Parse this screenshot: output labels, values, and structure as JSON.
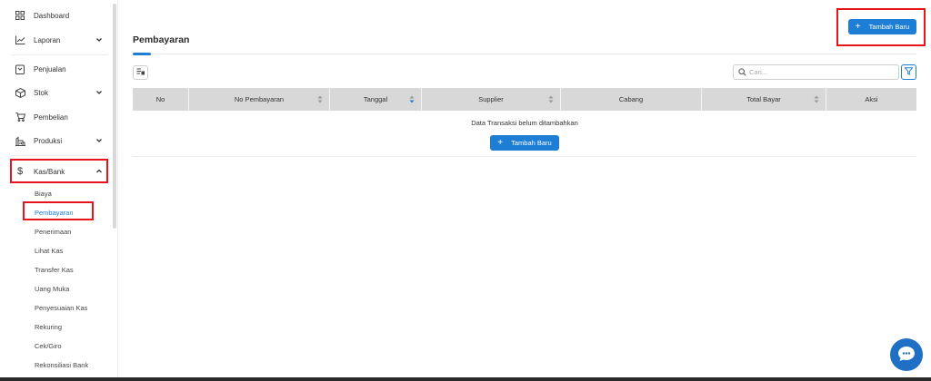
{
  "sidebar": {
    "items": [
      {
        "label": "Dashboard",
        "icon": "grid-icon"
      },
      {
        "label": "Laporan",
        "icon": "chart-line-icon",
        "expandable": true
      },
      {
        "label": "Penjualan",
        "icon": "receipt-icon"
      },
      {
        "label": "Stok",
        "icon": "box-icon",
        "expandable": true
      },
      {
        "label": "Pembelian",
        "icon": "cart-icon"
      },
      {
        "label": "Produksi",
        "icon": "factory-icon",
        "expandable": true
      },
      {
        "label": "Kas/Bank",
        "icon": "dollar-icon",
        "expandable": true,
        "expanded": true
      }
    ],
    "kas_bank_sub": [
      {
        "label": "Biaya"
      },
      {
        "label": "Pembayaran",
        "active": true
      },
      {
        "label": "Penerimaan"
      },
      {
        "label": "Lihat Kas"
      },
      {
        "label": "Transfer Kas"
      },
      {
        "label": "Uang Muka"
      },
      {
        "label": "Penyesuaian Kas"
      },
      {
        "label": "Rekuring"
      },
      {
        "label": "Cek/Giro"
      },
      {
        "label": "Rekonsiliasi Bank"
      }
    ]
  },
  "page": {
    "title": "Pembayaran",
    "add_button_label": "Tambah Baru"
  },
  "search": {
    "placeholder": "Cari..."
  },
  "table": {
    "columns": [
      {
        "label": "No",
        "sortable": false
      },
      {
        "label": "No Pembayaran",
        "sortable": true
      },
      {
        "label": "Tanggal",
        "sortable": true,
        "sorted": true
      },
      {
        "label": "Supplier",
        "sortable": true
      },
      {
        "label": "Cabang",
        "sortable": false
      },
      {
        "label": "Total Bayar",
        "sortable": true
      },
      {
        "label": "Aksi",
        "sortable": false
      }
    ],
    "empty_message": "Data Transaksi belum ditambahkan",
    "empty_add_label": "Tambah Baru"
  },
  "colors": {
    "accent": "#1e7ed6",
    "highlight": "#e8141c",
    "header_bg": "#d8d8d8"
  }
}
